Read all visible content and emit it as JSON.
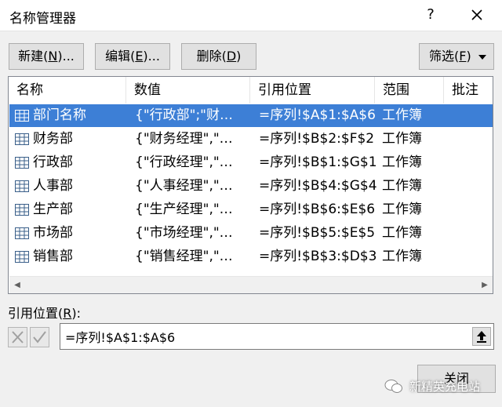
{
  "window": {
    "title": "名称管理器",
    "help": "?"
  },
  "toolbar": {
    "new": {
      "label": "新建(",
      "hotkey": "N",
      "suffix": ")..."
    },
    "edit": {
      "label": "编辑(",
      "hotkey": "E",
      "suffix": ")..."
    },
    "delete": {
      "label": "删除(",
      "hotkey": "D",
      "suffix": ")"
    },
    "filter": {
      "label": "筛选(",
      "hotkey": "F",
      "suffix": ")"
    }
  },
  "table": {
    "columns": [
      "名称",
      "数值",
      "引用位置",
      "范围",
      "批注"
    ],
    "rows": [
      {
        "name": "部门名称",
        "value": "{\"行政部\";\"财…",
        "ref": "=序列!$A$1:$A$6",
        "scope": "工作簿",
        "selected": true
      },
      {
        "name": "财务部",
        "value": "{\"财务经理\",\"…",
        "ref": "=序列!$B$2:$F$2",
        "scope": "工作簿",
        "selected": false
      },
      {
        "name": "行政部",
        "value": "{\"行政经理\",\"…",
        "ref": "=序列!$B$1:$G$1",
        "scope": "工作簿",
        "selected": false
      },
      {
        "name": "人事部",
        "value": "{\"人事经理\",\"…",
        "ref": "=序列!$B$4:$G$4",
        "scope": "工作簿",
        "selected": false
      },
      {
        "name": "生产部",
        "value": "{\"生产经理\",\"…",
        "ref": "=序列!$B$6:$E$6",
        "scope": "工作簿",
        "selected": false
      },
      {
        "name": "市场部",
        "value": "{\"市场经理\",\"…",
        "ref": "=序列!$B$5:$E$5",
        "scope": "工作簿",
        "selected": false
      },
      {
        "name": "销售部",
        "value": "{\"销售经理\",\"…",
        "ref": "=序列!$B$3:$D$3",
        "scope": "工作簿",
        "selected": false
      }
    ]
  },
  "reference": {
    "label": "引用位置(",
    "hotkey": "R",
    "suffix": "):",
    "value": "=序列!$A$1:$A$6"
  },
  "footer": {
    "close": "关闭",
    "watermark": "新精英充电站"
  },
  "colors": {
    "selection": "#3d7fd6",
    "button_face": "#e1e1e1"
  }
}
